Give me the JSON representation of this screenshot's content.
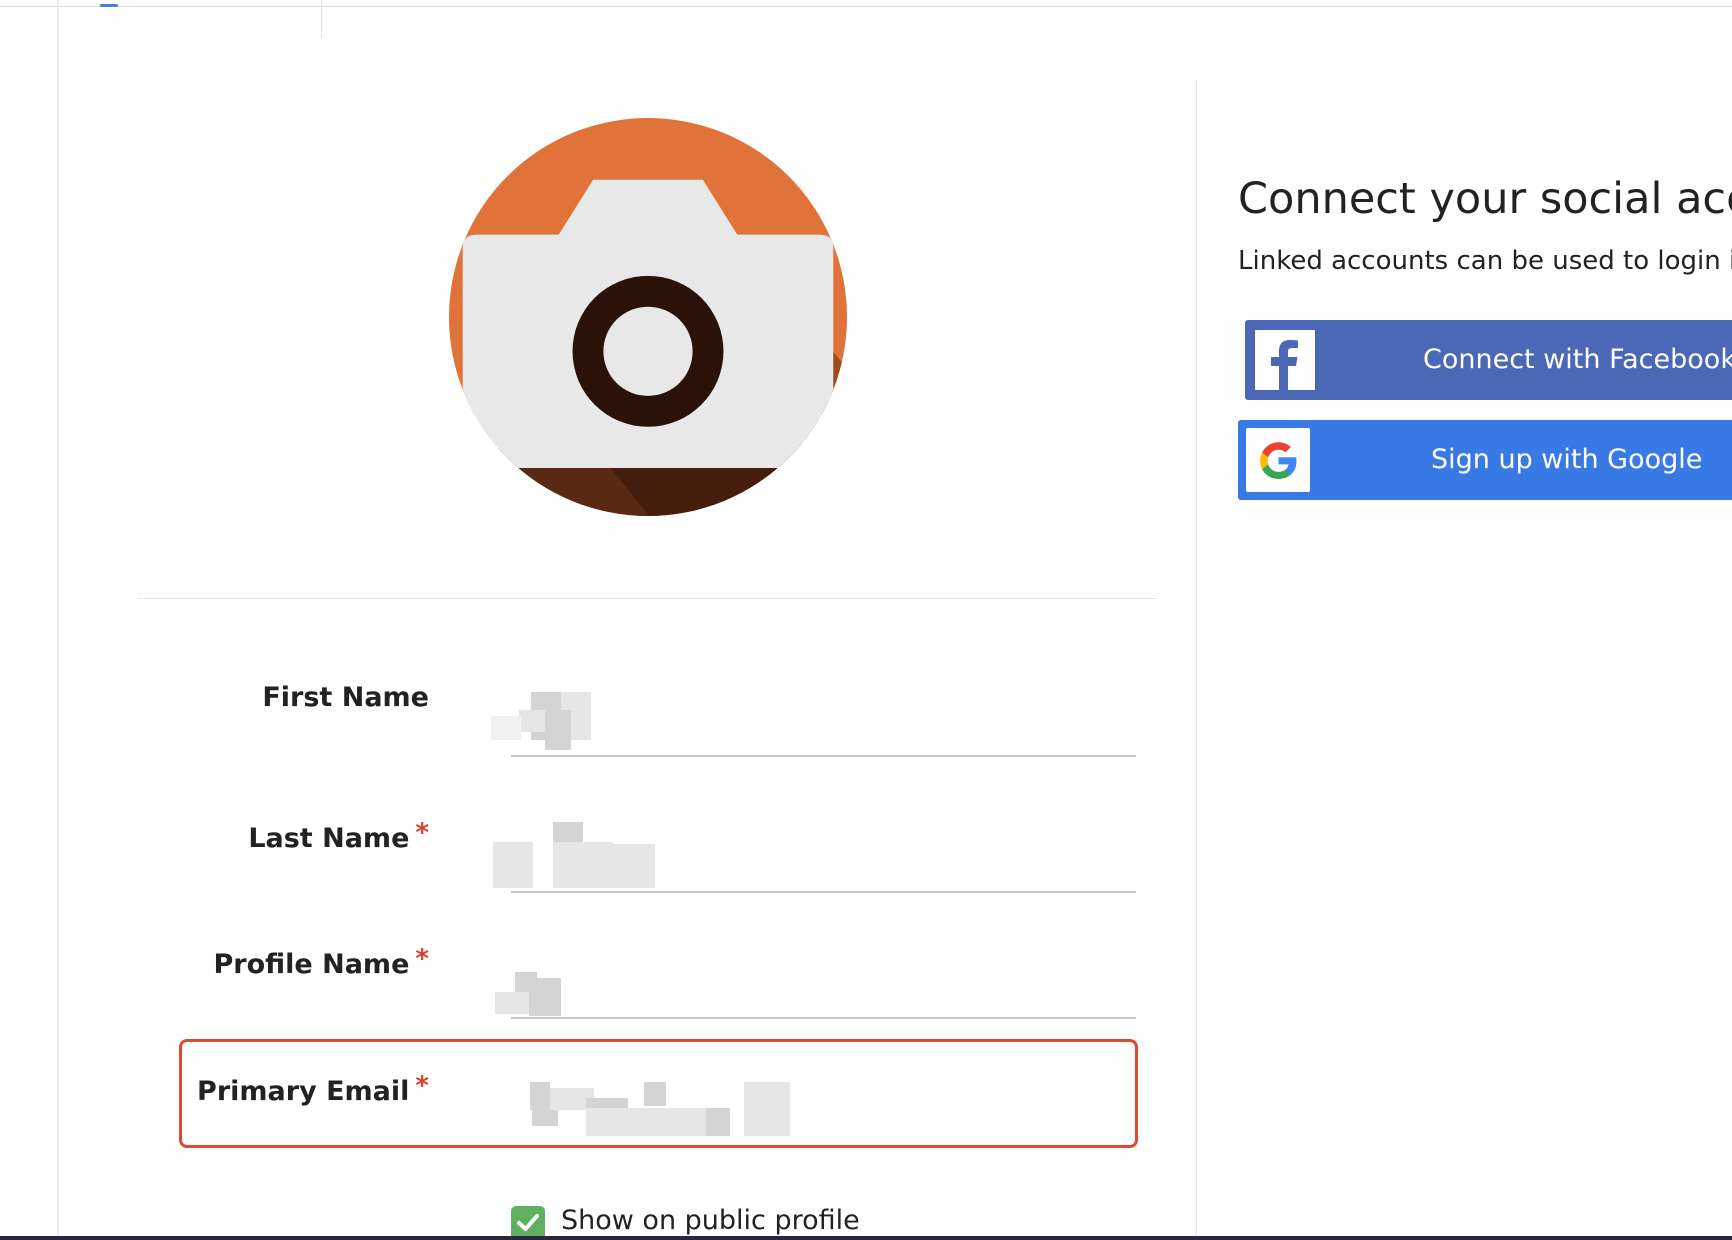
{
  "colors": {
    "avatar_bg": "#e0733a",
    "required_asterisk": "#d8432a",
    "highlight_border": "#dd4a2c",
    "facebook": "#4a68b5",
    "google": "#3879e6",
    "checkbox": "#5fb05f"
  },
  "avatar": {
    "icon": "user-silhouette-icon",
    "upload_icon": "camera-icon"
  },
  "form": {
    "first_name": {
      "label": "First Name",
      "required": false
    },
    "last_name": {
      "label": "Last Name",
      "required_mark": "*"
    },
    "profile_name": {
      "label": "Profile Name",
      "required_mark": "*"
    },
    "primary_email": {
      "label": "Primary Email",
      "required_mark": "*"
    },
    "show_public": {
      "label": "Show on public profile",
      "checked": true
    }
  },
  "social": {
    "title": "Connect your social accou",
    "subtitle": "Linked accounts can be used to login in to",
    "facebook_label": "Connect with Facebook",
    "google_label": "Sign up with Google"
  }
}
